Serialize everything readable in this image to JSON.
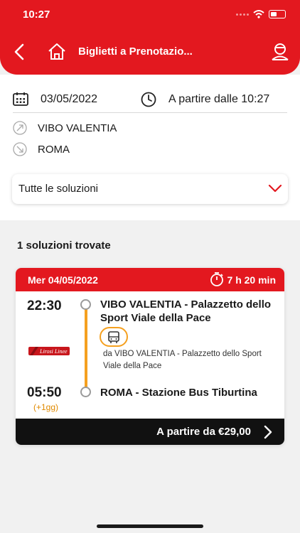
{
  "status_bar": {
    "time": "10:27"
  },
  "header": {
    "title": "Biglietti a Prenotazio...",
    "icons": [
      "chevron-left-icon",
      "home-icon",
      "user-icon"
    ]
  },
  "search": {
    "date": "03/05/2022",
    "time_label": "A partire dalle 10:27",
    "origin": "VIBO VALENTIA",
    "destination": "ROMA",
    "filter_value": "Tutte le soluzioni"
  },
  "results": {
    "count_label": "1 soluzioni trovate",
    "items": [
      {
        "date": "Mer 04/05/2022",
        "duration": "7 h 20 min",
        "departure_time": "22:30",
        "departure_stop": "VIBO VALENTIA - Palazzetto dello Sport Viale della Pace",
        "from_text": "da VIBO VALENTIA - Palazzetto dello Sport Viale della Pace",
        "arrival_time": "05:50",
        "arrival_next_day": "(+1gg)",
        "arrival_stop": "ROMA - Stazione Bus Tiburtina",
        "carrier": "Lirosi Linee",
        "price_label": "A partire da €29,00"
      }
    ]
  },
  "colors": {
    "brand_red": "#e3181f",
    "accent_orange": "#f5a01f",
    "footer_black": "#111111"
  }
}
